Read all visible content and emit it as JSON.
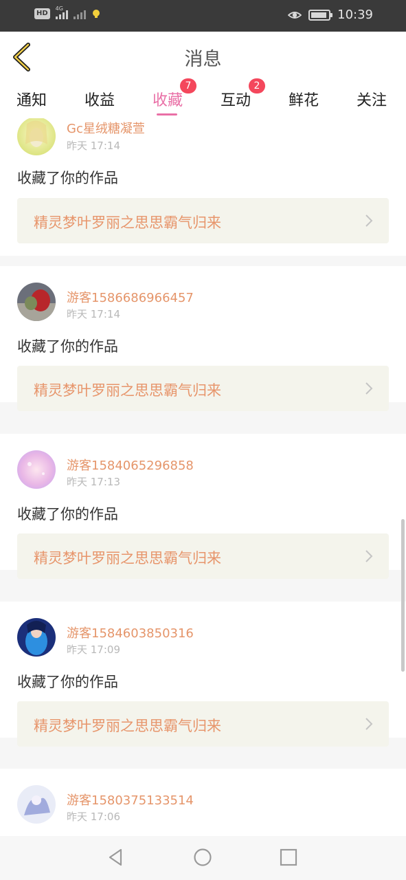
{
  "status_bar": {
    "hd_label": "HD",
    "network_label": "4G",
    "time": "10:39",
    "icons": [
      "eye-icon",
      "battery-icon"
    ]
  },
  "header": {
    "title": "消息",
    "back_icon": "chevron-left-icon"
  },
  "tabs": [
    {
      "label": "通知"
    },
    {
      "label": "收益"
    },
    {
      "label": "收藏",
      "badge": "7",
      "active": true
    },
    {
      "label": "互动",
      "badge": "2"
    },
    {
      "label": "鲜花"
    },
    {
      "label": "关注"
    }
  ],
  "items": [
    {
      "username": "Gc星绒糖凝萱",
      "time": "昨天 17:14",
      "action": "收藏了你的作品",
      "work": "精灵梦叶罗丽之思思霸气归来"
    },
    {
      "username": "游客1586686966457",
      "time": "昨天 17:14",
      "action": "收藏了你的作品",
      "work": "精灵梦叶罗丽之思思霸气归来"
    },
    {
      "username": "游客1584065296858",
      "time": "昨天 17:13",
      "action": "收藏了你的作品",
      "work": "精灵梦叶罗丽之思思霸气归来"
    },
    {
      "username": "游客1584603850316",
      "time": "昨天 17:09",
      "action": "收藏了你的作品",
      "work": "精灵梦叶罗丽之思思霸气归来"
    },
    {
      "username": "游客1580375133514",
      "time": "昨天 17:06"
    }
  ],
  "colors": {
    "accent": "#e96fa6",
    "badge": "#f4475c",
    "username": "#e5956a",
    "work_title": "#e7956b"
  }
}
